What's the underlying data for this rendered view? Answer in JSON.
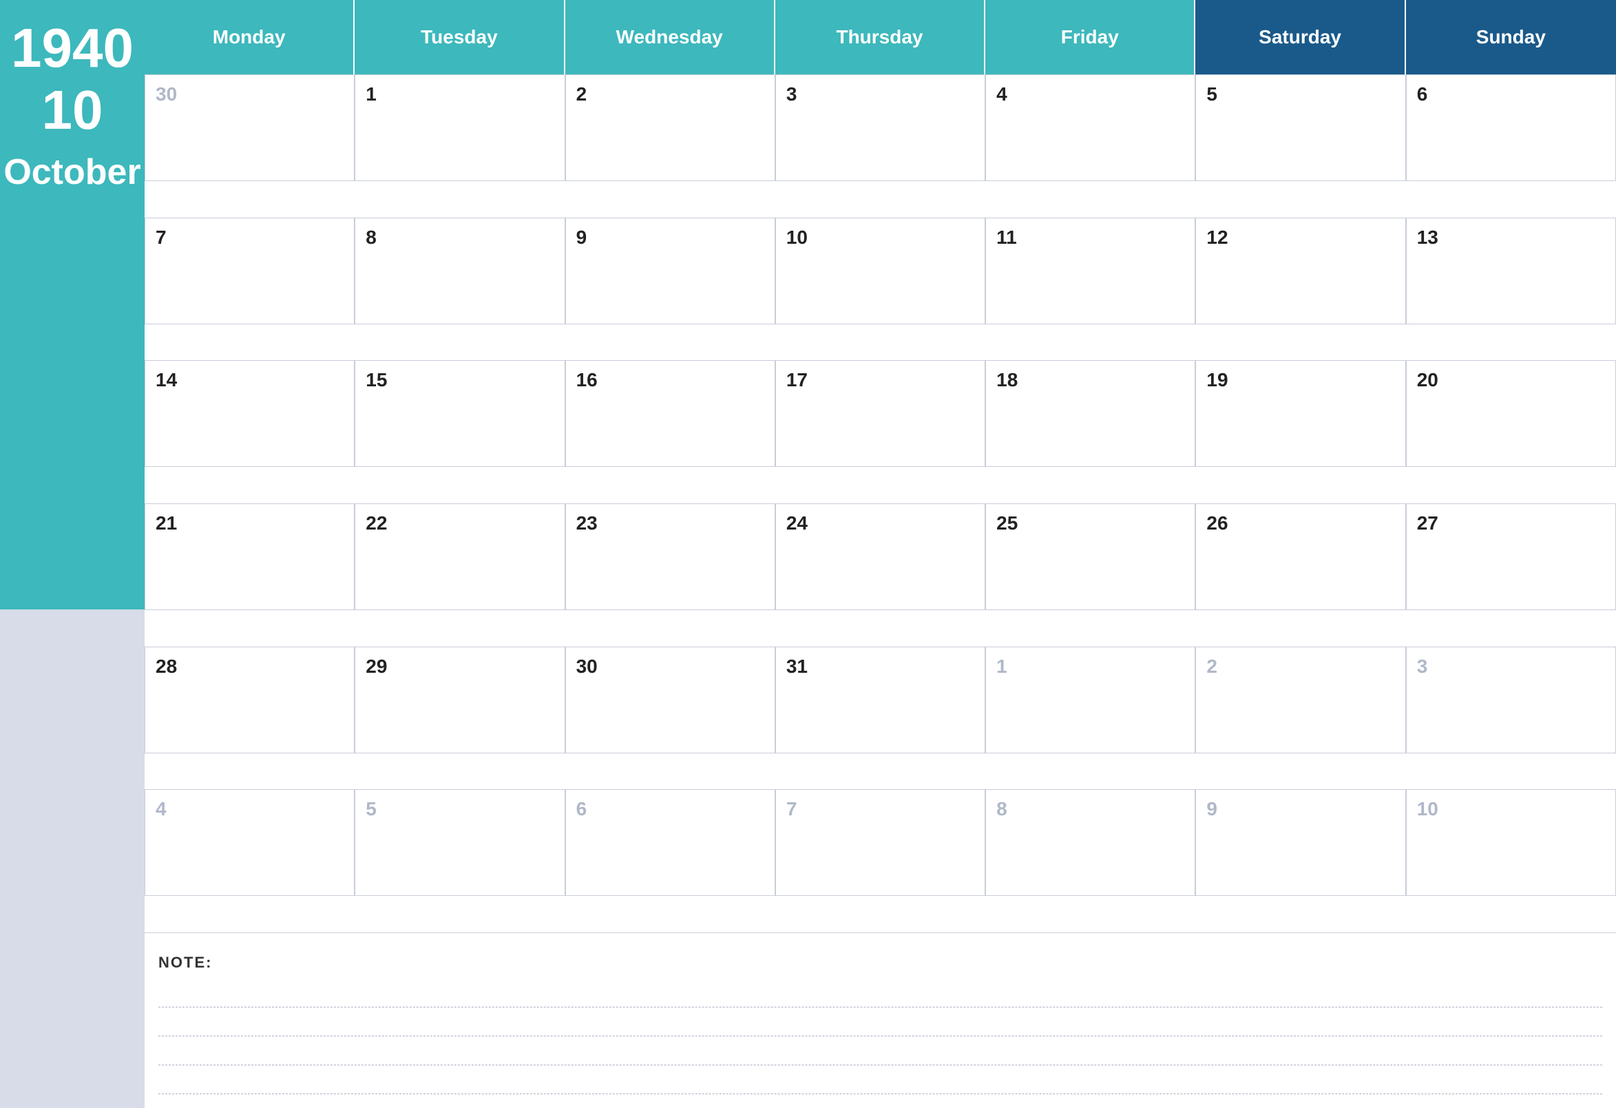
{
  "sidebar": {
    "year": "1940",
    "day": "10",
    "month": "October"
  },
  "header": {
    "days": [
      {
        "label": "Monday",
        "class": "weekday"
      },
      {
        "label": "Tuesday",
        "class": "weekday"
      },
      {
        "label": "Wednesday",
        "class": "weekday"
      },
      {
        "label": "Thursday",
        "class": "weekday"
      },
      {
        "label": "Friday",
        "class": "weekday"
      },
      {
        "label": "Saturday",
        "class": "saturday"
      },
      {
        "label": "Sunday",
        "class": "sunday"
      }
    ]
  },
  "calendar": {
    "weeks": [
      [
        {
          "number": "30",
          "outside": true
        },
        {
          "number": "1",
          "outside": false
        },
        {
          "number": "2",
          "outside": false
        },
        {
          "number": "3",
          "outside": false
        },
        {
          "number": "4",
          "outside": false
        },
        {
          "number": "5",
          "outside": false
        },
        {
          "number": "6",
          "outside": false
        }
      ],
      [
        {
          "number": "7",
          "outside": false
        },
        {
          "number": "8",
          "outside": false
        },
        {
          "number": "9",
          "outside": false
        },
        {
          "number": "10",
          "outside": false
        },
        {
          "number": "11",
          "outside": false
        },
        {
          "number": "12",
          "outside": false
        },
        {
          "number": "13",
          "outside": false
        }
      ],
      [
        {
          "number": "14",
          "outside": false
        },
        {
          "number": "15",
          "outside": false
        },
        {
          "number": "16",
          "outside": false
        },
        {
          "number": "17",
          "outside": false
        },
        {
          "number": "18",
          "outside": false
        },
        {
          "number": "19",
          "outside": false
        },
        {
          "number": "20",
          "outside": false
        }
      ],
      [
        {
          "number": "21",
          "outside": false
        },
        {
          "number": "22",
          "outside": false
        },
        {
          "number": "23",
          "outside": false
        },
        {
          "number": "24",
          "outside": false
        },
        {
          "number": "25",
          "outside": false
        },
        {
          "number": "26",
          "outside": false
        },
        {
          "number": "27",
          "outside": false
        }
      ],
      [
        {
          "number": "28",
          "outside": false
        },
        {
          "number": "29",
          "outside": false
        },
        {
          "number": "30",
          "outside": false
        },
        {
          "number": "31",
          "outside": false
        },
        {
          "number": "1",
          "outside": true
        },
        {
          "number": "2",
          "outside": true
        },
        {
          "number": "3",
          "outside": true
        }
      ],
      [
        {
          "number": "4",
          "outside": true
        },
        {
          "number": "5",
          "outside": true
        },
        {
          "number": "6",
          "outside": true
        },
        {
          "number": "7",
          "outside": true
        },
        {
          "number": "8",
          "outside": true
        },
        {
          "number": "9",
          "outside": true
        },
        {
          "number": "10",
          "outside": true
        }
      ]
    ]
  },
  "notes": {
    "label": "NOTE:",
    "lines": 4
  }
}
